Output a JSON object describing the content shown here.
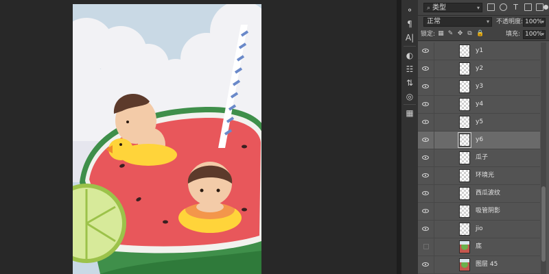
{
  "toolstrip": {
    "tools": [
      {
        "name": "history-icon",
        "glyph": "⚬"
      },
      {
        "name": "paragraph-icon",
        "glyph": "¶"
      },
      {
        "name": "character-icon",
        "glyph": "A|"
      },
      {
        "name": "adjustments-icon",
        "glyph": "◐"
      },
      {
        "name": "properties-icon",
        "glyph": "☷"
      },
      {
        "name": "channels-icon",
        "glyph": "⇅"
      },
      {
        "name": "paths-icon",
        "glyph": "◎"
      },
      {
        "name": "brush-presets-icon",
        "glyph": "▦"
      }
    ]
  },
  "layers_panel": {
    "filter": {
      "search_glyph": "⌕",
      "kind_label": "类型"
    },
    "filter_icons": [
      "image-filter-icon",
      "adjustment-filter-icon",
      "type-filter-icon",
      "shape-filter-icon",
      "smart-object-filter-icon",
      "filter-toggle-icon"
    ],
    "blend_mode": "正常",
    "opacity": {
      "label": "不透明度:",
      "value": "100%"
    },
    "lock": {
      "label": "锁定:"
    },
    "fill": {
      "label": "填充:",
      "value": "100%"
    },
    "layers": [
      {
        "name": "y1",
        "visible": true,
        "selected": false,
        "thumb": "empty"
      },
      {
        "name": "y2",
        "visible": true,
        "selected": false,
        "thumb": "empty"
      },
      {
        "name": "y3",
        "visible": true,
        "selected": false,
        "thumb": "empty"
      },
      {
        "name": "y4",
        "visible": true,
        "selected": false,
        "thumb": "empty"
      },
      {
        "name": "y5",
        "visible": true,
        "selected": false,
        "thumb": "empty"
      },
      {
        "name": "y6",
        "visible": true,
        "selected": true,
        "thumb": "empty"
      },
      {
        "name": "瓜子",
        "visible": true,
        "selected": false,
        "thumb": "empty"
      },
      {
        "name": "环境光",
        "visible": true,
        "selected": false,
        "thumb": "empty"
      },
      {
        "name": "西瓜波纹",
        "visible": true,
        "selected": false,
        "thumb": "empty"
      },
      {
        "name": "吸管阴影",
        "visible": true,
        "selected": false,
        "thumb": "empty"
      },
      {
        "name": "jio",
        "visible": true,
        "selected": false,
        "thumb": "empty"
      },
      {
        "name": "底",
        "visible": false,
        "selected": false,
        "thumb": "image"
      },
      {
        "name": "图层 45",
        "visible": true,
        "selected": false,
        "thumb": "image"
      }
    ]
  },
  "colors": {
    "workspace": "#282828",
    "panel": "#535353",
    "selected_row": "#6a6a6a",
    "sky": "#c9d9e5",
    "watermelon_flesh": "#e8575b",
    "rind": "#3f8f4a",
    "duck": "#ffd43a",
    "lime": "#c4dc7a"
  }
}
